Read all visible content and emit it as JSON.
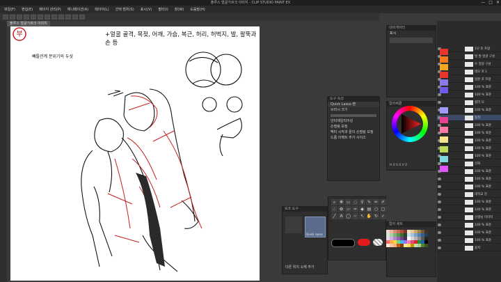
{
  "window": {
    "title": "플루스 얼굴가르크 이미지 - CLIP STUDIO PAINT EX",
    "buttons": [
      "—",
      "□",
      "✕"
    ]
  },
  "menu": [
    "파일(F)",
    "편집(E)",
    "페이지 관리(P)",
    "애니메이션(A)",
    "레이어(L)",
    "선택 범위(S)",
    "표시(V)",
    "필터(I)",
    "창(W)",
    "도움말(H)"
  ],
  "tab": {
    "label": "플루스 얼굴가르크 이미지"
  },
  "canvas": {
    "title": "+얼굴 골격, 목젖, 어깨, 가슴, 복근, 허리, 허벅지, 발, 팔뚝과 손 등",
    "caption": "빼틀관계 분위기의 두샷",
    "logo_glyph": "부"
  },
  "tool_property": {
    "header": "도구 속성",
    "tool_name": "Quick Lasso 펜",
    "rows": [
      "브러시 크기",
      "안티에일리어싱",
      "손떨림 보정",
      "벡터 시작과 끝의 손떨림 보정",
      "드롭 이펙트 추가 사이즈"
    ]
  },
  "subtool": {
    "header": "보조 도구",
    "item_label": "Quick Lasso",
    "footer": "다른 위치 소재 추가"
  },
  "navigator": {
    "header": "내비게이터",
    "label": "표시"
  },
  "color_wheel": {
    "header": "컬러써클",
    "hsv": "H 0 S 0 V 0"
  },
  "color_set": {
    "header": "컬러 세트",
    "label": "기본 컬러 세트"
  },
  "colors": {
    "accent": "#c81e1e",
    "main_color": "#000000",
    "sub_color": "#e41b1b"
  },
  "layer_chips": [
    "#e8372a",
    "#f47b20",
    "#f5a623",
    "#e8372a",
    "#8c7ae6",
    "#6c5ce7",
    "#a29bfe",
    "#e84393",
    "#fd79a8",
    "#f6e58d",
    "#badc58",
    "#7ed6df",
    "#e056fd"
  ],
  "layers": [
    {
      "name": "1모 포 프랑"
    },
    {
      "name": "발 발 얼굴 구성"
    },
    {
      "name": "우 얼굴 구성"
    },
    {
      "name": "데오 포 1"
    },
    {
      "name": "일본 포 프랑"
    },
    {
      "name": "100 % 표준"
    },
    {
      "name": "100 % 표준"
    },
    {
      "name": "컬러 모"
    },
    {
      "name": "100 % 표준"
    },
    {
      "name": "동작"
    },
    {
      "name": "100 % 표준"
    },
    {
      "name": "100 % 표준"
    },
    {
      "name": "100 % 표준"
    },
    {
      "name": "100 % 표준"
    },
    {
      "name": "100 % 표준"
    },
    {
      "name": "선화"
    },
    {
      "name": "100 % 표준"
    },
    {
      "name": "100 % 표준"
    },
    {
      "name": "100 % 표준"
    },
    {
      "name": "대학교 진"
    },
    {
      "name": "100 % 표준"
    },
    {
      "name": "100 % 표준"
    },
    {
      "name": "선생님 이미지"
    },
    {
      "name": "100 % 표준"
    },
    {
      "name": "100 % 표준"
    },
    {
      "name": "100 % 표준"
    },
    {
      "name": "용지"
    }
  ]
}
